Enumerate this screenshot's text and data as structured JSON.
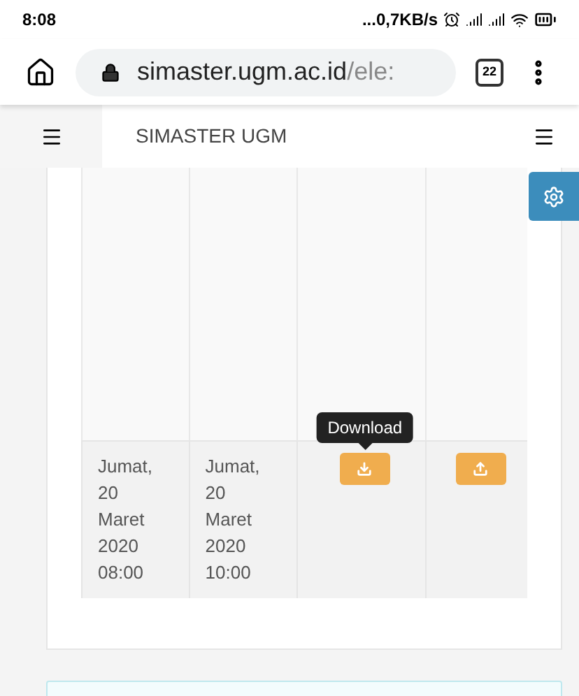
{
  "status_bar": {
    "time": "8:08",
    "network_speed": "...0,7KB/s"
  },
  "browser": {
    "url_host": "simaster.ugm.ac.id",
    "url_path": "/ele:",
    "tab_count": "22"
  },
  "app_header": {
    "title": "SIMASTER UGM"
  },
  "table": {
    "rows": [
      {
        "cells": [
          {
            "kind": "text",
            "text": "Jumat, 20 Maret 2020 08:00"
          },
          {
            "kind": "text",
            "text": "Jumat, 20 Maret 2020 10:00"
          },
          {
            "kind": "download",
            "tooltip": "Download"
          },
          {
            "kind": "upload"
          }
        ]
      }
    ]
  }
}
